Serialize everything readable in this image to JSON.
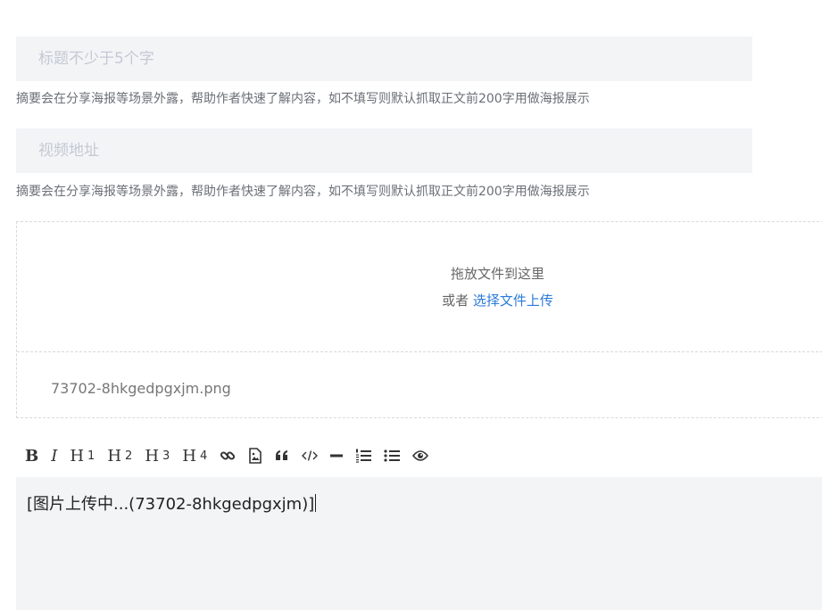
{
  "form": {
    "title_placeholder": "标题不少于5个字",
    "video_placeholder": "视频地址",
    "summary_hint_1": "摘要会在分享海报等场景外露，帮助作者快速了解内容，如不填写则默认抓取正文前200字用做海报展示",
    "summary_hint_2": "摘要会在分享海报等场景外露，帮助作者快速了解内容，如不填写则默认抓取正文前200字用做海报展示"
  },
  "upload": {
    "drop_text": "拖放文件到这里",
    "or_text": "或者",
    "choose_link": "选择文件上传",
    "files": [
      "73702-8hkgedpgxjm.png"
    ]
  },
  "toolbar": {
    "bold": "B",
    "italic": "I",
    "h1": "H",
    "h1_num": "1",
    "h2": "H",
    "h2_num": "2",
    "h3": "H",
    "h3_num": "3",
    "h4": "H",
    "h4_num": "4",
    "icons": [
      "link-icon",
      "image-icon",
      "quote-icon",
      "code-icon",
      "horizontal-rule-icon",
      "ordered-list-icon",
      "unordered-list-icon",
      "preview-eye-icon"
    ]
  },
  "editor": {
    "content": "[图片上传中...(73702-8hkgedpgxjm)]"
  }
}
